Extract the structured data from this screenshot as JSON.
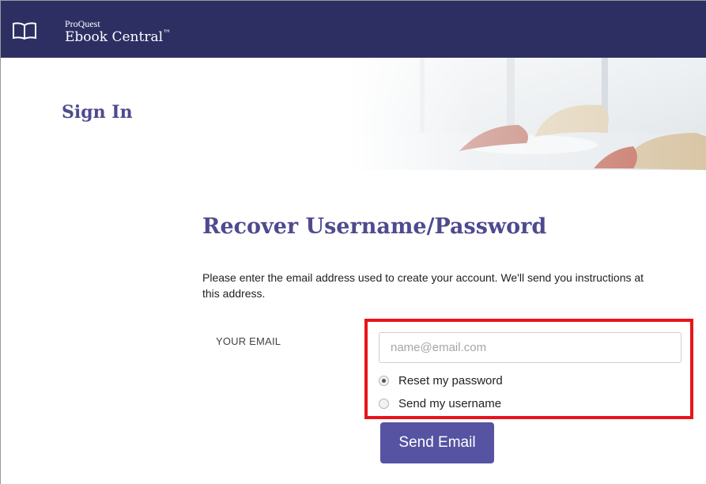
{
  "header": {
    "brand_small": "ProQuest",
    "brand_name": "Ebook Central",
    "brand_tm": "™",
    "logo_icon": "open-book-icon"
  },
  "signin": {
    "title": "Sign In"
  },
  "recover": {
    "title": "Recover Username/Password",
    "instructions": "Please enter the email address used to create your account. We'll send you instructions at this address.",
    "email_label": "YOUR EMAIL",
    "email_placeholder": "name@email.com",
    "email_value": "",
    "options": [
      {
        "label": "Reset my password",
        "checked": true
      },
      {
        "label": "Send my username",
        "checked": false
      }
    ],
    "send_button": "Send Email"
  },
  "colors": {
    "header_bg": "#2d2f63",
    "title_color": "#4f4a8f",
    "button_bg": "#5653a3",
    "highlight": "#e8141b"
  }
}
